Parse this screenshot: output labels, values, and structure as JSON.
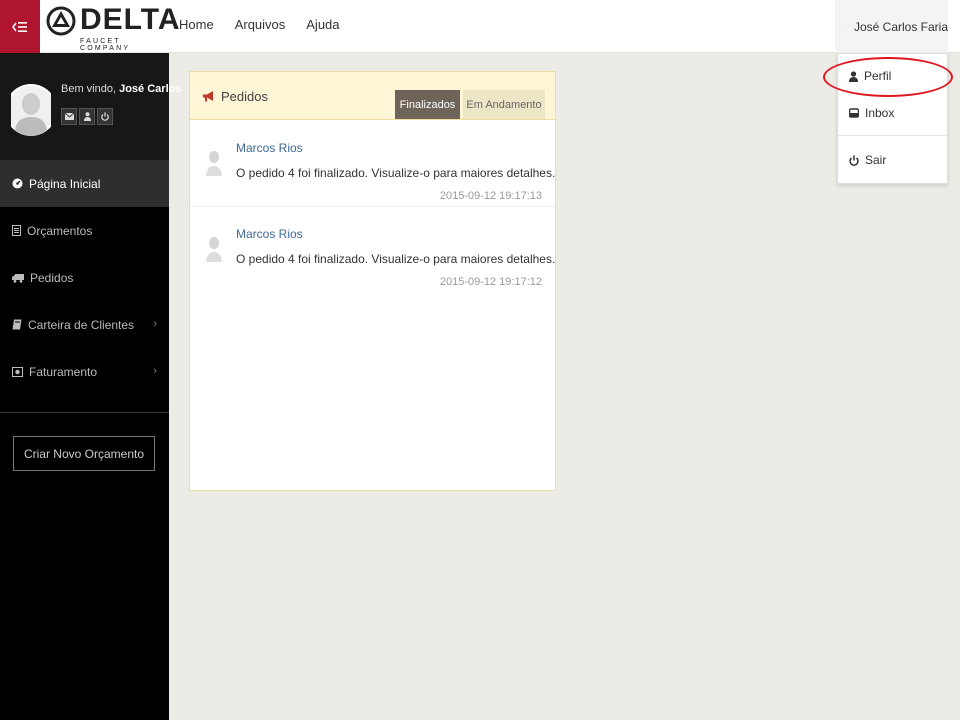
{
  "brand": {
    "name": "DELTA",
    "tagline": "FAUCET COMPANY"
  },
  "topnav": {
    "items": [
      {
        "label": "Home"
      },
      {
        "label": "Arquivos"
      },
      {
        "label": "Ajuda"
      }
    ]
  },
  "user": {
    "name": "José Carlos Faria"
  },
  "dropdown": {
    "items": [
      {
        "label": "Perfil",
        "icon": "user-icon"
      },
      {
        "label": "Inbox",
        "icon": "inbox-icon"
      },
      {
        "label": "Sair",
        "icon": "power-icon"
      }
    ]
  },
  "sidebar": {
    "welcome_prefix": "Bem vindo,",
    "welcome_name": "José Carlos",
    "items": [
      {
        "label": "Página Inicial",
        "icon": "dashboard-icon",
        "active": true
      },
      {
        "label": "Orçamentos",
        "icon": "document-icon"
      },
      {
        "label": "Pedidos",
        "icon": "truck-icon"
      },
      {
        "label": "Carteira de Clientes",
        "icon": "book-icon",
        "chevron": "›"
      },
      {
        "label": "Faturamento",
        "icon": "money-icon",
        "chevron": "›"
      }
    ],
    "new_button": "Criar Novo Orçamento"
  },
  "panel": {
    "title": "Pedidos",
    "tabs": [
      {
        "label": "Finalizados",
        "active": true
      },
      {
        "label": "Em Andamento"
      }
    ],
    "messages": [
      {
        "author": "Marcos Rios",
        "text": "O pedido 4 foi finalizado. Visualize-o para maiores detalhes.",
        "time": "2015-09-12 19:17:13"
      },
      {
        "author": "Marcos Rios",
        "text": "O pedido 4 foi finalizado. Visualize-o para maiores detalhes.",
        "time": "2015-09-12 19:17:12"
      }
    ]
  },
  "colors": {
    "accent": "#b0152f",
    "highlight": "#e0161e",
    "link": "#3d6a96",
    "panel_header": "#fcf6d7"
  }
}
